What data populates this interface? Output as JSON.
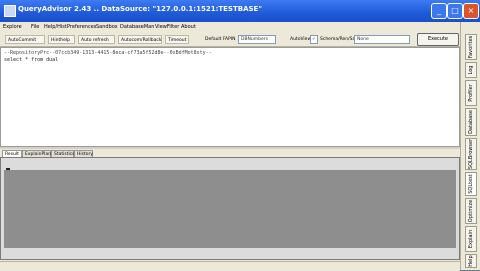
{
  "window": {
    "title": "QueryAdvisor 2.43 .. DataSource: \"127.0.0.1:1521:TESTBASE\""
  },
  "menu": [
    "Explore",
    "File",
    "Help/Hist",
    "Preferences",
    "Sandbox",
    "DatabaseMan",
    "ViewFilter",
    "About"
  ],
  "toolbar": {
    "buttons": [
      "AutoCommit",
      "Hinthelp",
      "Auto refresh",
      "Autocom/Rollback",
      "Timeout"
    ],
    "fetch_label": "Default FAPIN",
    "fetch_value": "DBNumbers",
    "autoview_label": "AutoView",
    "autoview_check": "✓",
    "schema_label": "Schema/Ren/Sa",
    "schema_value": "None",
    "execute_label": "Execute"
  },
  "editor": {
    "lines": [
      "--RepositoryPrc--07ccb349-1313-4415-8eca-cf73a5f52d8e--0xBdfMot8sty--",
      "select * from dual"
    ]
  },
  "result_tabs": [
    "Result",
    "ExplainPlan",
    "Statistics",
    "History"
  ],
  "sidebar_tabs": [
    "Favorites",
    "Log",
    "Profiler",
    "Database",
    "SQLBrowser",
    "SQLtest",
    "Optimize",
    "Explain",
    "Help"
  ],
  "colors": {
    "titlebar": "#1f5ad9",
    "window_bg": "#ece9d8",
    "results_bg": "#8e8e8e"
  }
}
